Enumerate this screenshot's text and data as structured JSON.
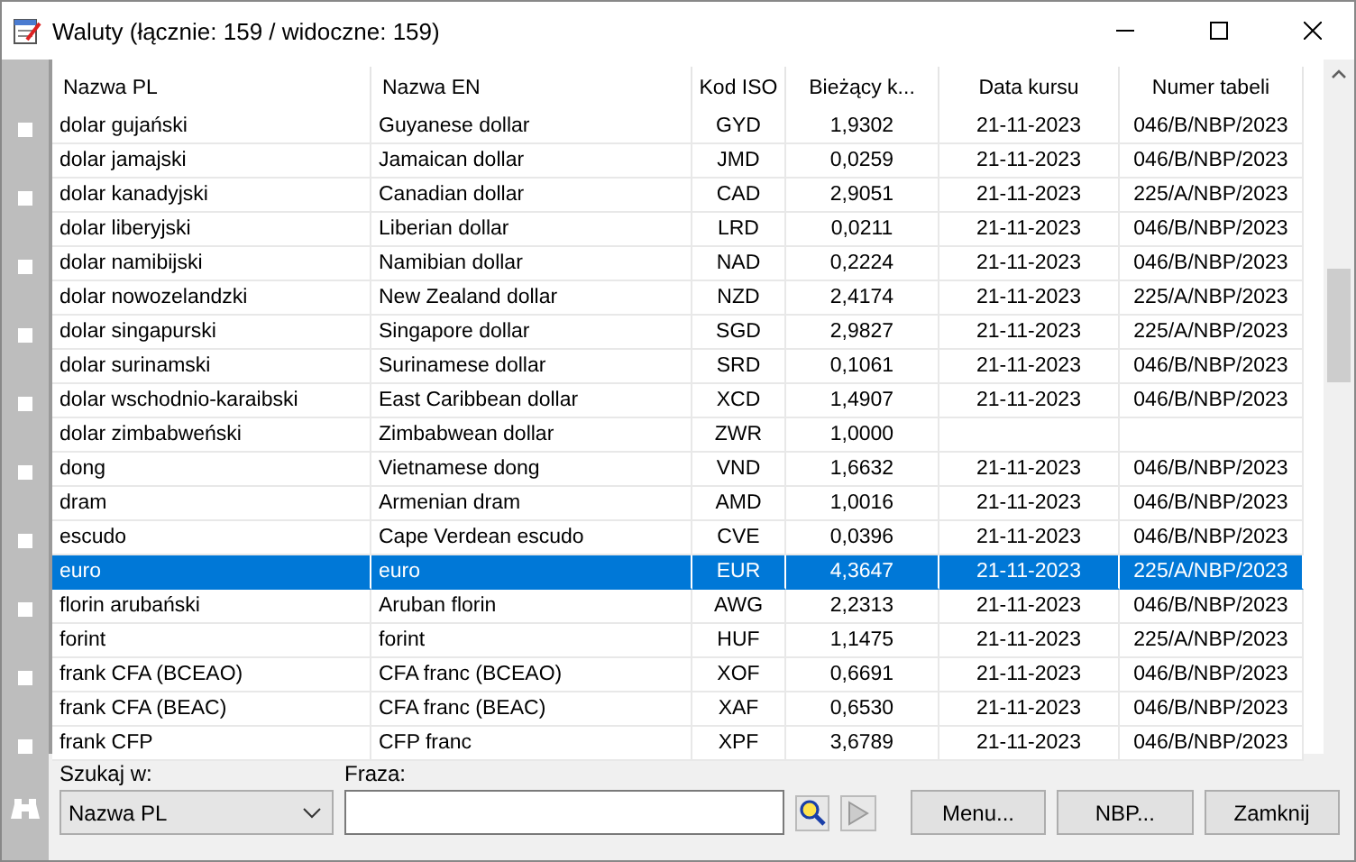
{
  "window": {
    "title": "Waluty (łącznie: 159 / widoczne: 159)"
  },
  "table": {
    "columns": [
      "Nazwa PL",
      "Nazwa EN",
      "Kod ISO",
      "Bieżący k...",
      "Data kursu",
      "Numer tabeli"
    ],
    "rows": [
      {
        "cells": [
          "dolar gujański",
          "Guyanese dollar",
          "GYD",
          "1,9302",
          "21-11-2023",
          "046/B/NBP/2023"
        ],
        "selected": false
      },
      {
        "cells": [
          "dolar jamajski",
          "Jamaican dollar",
          "JMD",
          "0,0259",
          "21-11-2023",
          "046/B/NBP/2023"
        ],
        "selected": false
      },
      {
        "cells": [
          "dolar kanadyjski",
          "Canadian dollar",
          "CAD",
          "2,9051",
          "21-11-2023",
          "225/A/NBP/2023"
        ],
        "selected": false
      },
      {
        "cells": [
          "dolar liberyjski",
          "Liberian dollar",
          "LRD",
          "0,0211",
          "21-11-2023",
          "046/B/NBP/2023"
        ],
        "selected": false
      },
      {
        "cells": [
          "dolar namibijski",
          "Namibian dollar",
          "NAD",
          "0,2224",
          "21-11-2023",
          "046/B/NBP/2023"
        ],
        "selected": false
      },
      {
        "cells": [
          "dolar nowozelandzki",
          "New Zealand dollar",
          "NZD",
          "2,4174",
          "21-11-2023",
          "225/A/NBP/2023"
        ],
        "selected": false
      },
      {
        "cells": [
          "dolar singapurski",
          "Singapore dollar",
          "SGD",
          "2,9827",
          "21-11-2023",
          "225/A/NBP/2023"
        ],
        "selected": false
      },
      {
        "cells": [
          "dolar surinamski",
          "Surinamese dollar",
          "SRD",
          "0,1061",
          "21-11-2023",
          "046/B/NBP/2023"
        ],
        "selected": false
      },
      {
        "cells": [
          "dolar wschodnio-karaibski",
          "East Caribbean dollar",
          "XCD",
          "1,4907",
          "21-11-2023",
          "046/B/NBP/2023"
        ],
        "selected": false
      },
      {
        "cells": [
          "dolar zimbabweński",
          "Zimbabwean dollar",
          "ZWR",
          "1,0000",
          null,
          null
        ],
        "selected": false
      },
      {
        "cells": [
          "dong",
          "Vietnamese dong",
          "VND",
          "1,6632",
          "21-11-2023",
          "046/B/NBP/2023"
        ],
        "selected": false
      },
      {
        "cells": [
          "dram",
          "Armenian dram",
          "AMD",
          "1,0016",
          "21-11-2023",
          "046/B/NBP/2023"
        ],
        "selected": false
      },
      {
        "cells": [
          "escudo",
          "Cape Verdean escudo",
          "CVE",
          "0,0396",
          "21-11-2023",
          "046/B/NBP/2023"
        ],
        "selected": false
      },
      {
        "cells": [
          "euro",
          "euro",
          "EUR",
          "4,3647",
          "21-11-2023",
          "225/A/NBP/2023"
        ],
        "selected": true
      },
      {
        "cells": [
          "florin arubański",
          "Aruban florin",
          "AWG",
          "2,2313",
          "21-11-2023",
          "046/B/NBP/2023"
        ],
        "selected": false
      },
      {
        "cells": [
          "forint",
          "forint",
          "HUF",
          "1,1475",
          "21-11-2023",
          "225/A/NBP/2023"
        ],
        "selected": false
      },
      {
        "cells": [
          "frank CFA (BCEAO)",
          "CFA franc (BCEAO)",
          "XOF",
          "0,6691",
          "21-11-2023",
          "046/B/NBP/2023"
        ],
        "selected": false
      },
      {
        "cells": [
          "frank CFA (BEAC)",
          "CFA franc (BEAC)",
          "XAF",
          "0,6530",
          "21-11-2023",
          "046/B/NBP/2023"
        ],
        "selected": false
      },
      {
        "cells": [
          "frank CFP",
          "CFP franc",
          "XPF",
          "3,6789",
          "21-11-2023",
          "046/B/NBP/2023"
        ],
        "selected": false
      }
    ]
  },
  "search": {
    "field_label": "Szukaj w:",
    "field_value": "Nazwa PL",
    "phrase_label": "Fraza:"
  },
  "buttons": [
    "Menu...",
    "NBP...",
    "Zamknij"
  ]
}
